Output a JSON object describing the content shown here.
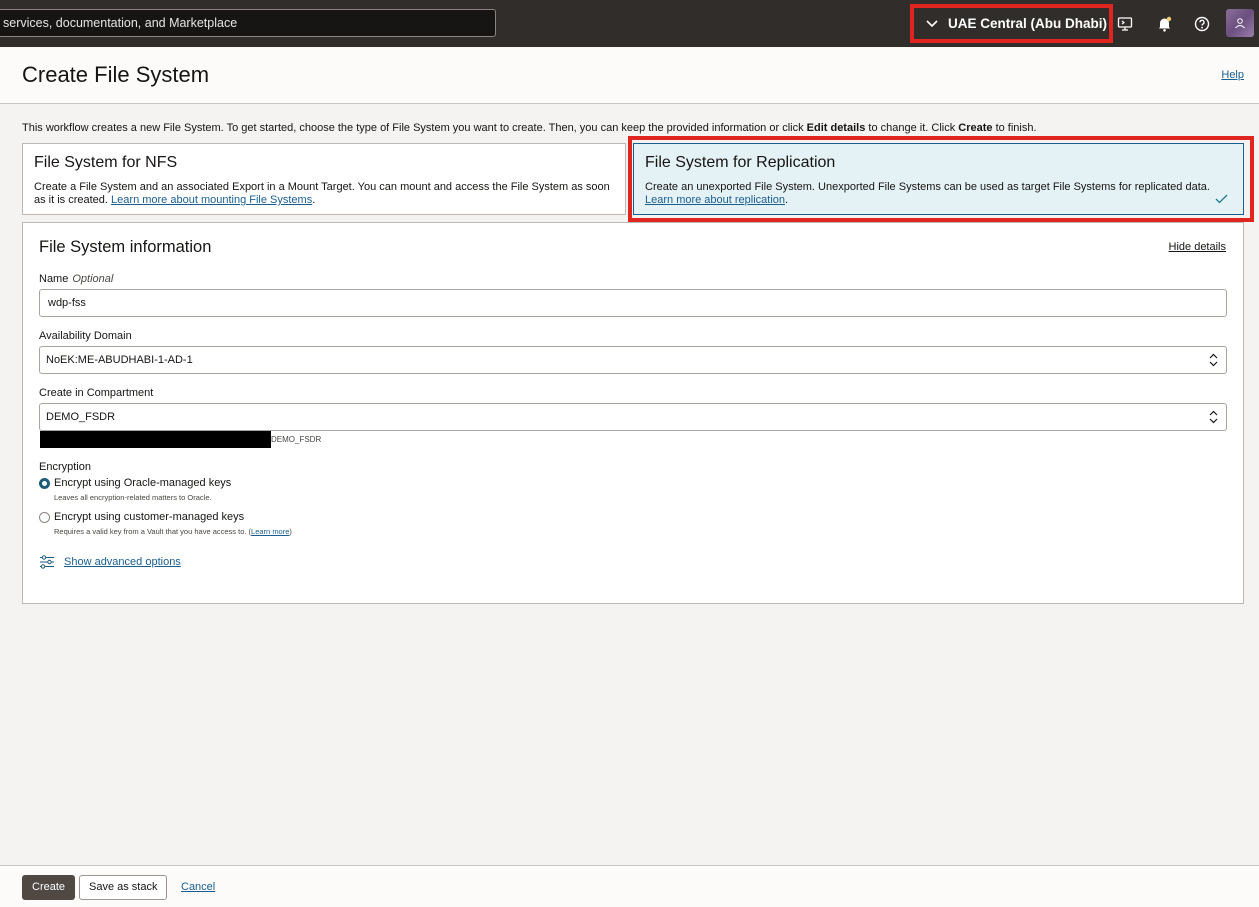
{
  "topbar": {
    "search_placeholder": "services, documentation, and Marketplace",
    "region": "UAE Central (Abu Dhabi)",
    "icons": [
      "cloud-shell-icon",
      "bell-icon",
      "help-icon",
      "avatar-icon"
    ]
  },
  "header": {
    "title": "Create File System",
    "help": "Help"
  },
  "intro": {
    "text1": "This workflow creates a new File System. To get started, choose the type of File System you want to create. Then, you can keep the provided information or click ",
    "bold1": "Edit details",
    "text2": " to change it. Click ",
    "bold2": "Create",
    "text3": " to finish."
  },
  "cards": {
    "nfs": {
      "title": "File System for NFS",
      "desc": "Create a File System and an associated Export in a Mount Target. You can mount and access the File System as soon as it is created. ",
      "link": "Learn more about mounting File Systems",
      "tail": "."
    },
    "replication": {
      "title": "File System for Replication",
      "desc": "Create an unexported File System. Unexported File Systems can be used as target File Systems for replicated data. ",
      "link": "Learn more about replication",
      "tail": ".",
      "selected": true
    }
  },
  "form": {
    "section_title": "File System information",
    "hide_details": "Hide details",
    "name_label": "Name",
    "name_optional": "Optional",
    "name_value": "wdp-fss",
    "ad_label": "Availability Domain",
    "ad_value": "NoEK:ME-ABUDHABI-1-AD-1",
    "compartment_label": "Create in Compartment",
    "compartment_value": "DEMO_FSDR",
    "compartment_path_tail": "DEMO_FSDR",
    "encryption_label": "Encryption",
    "enc_oracle_label": "Encrypt using Oracle-managed keys",
    "enc_oracle_sub": "Leaves all encryption-related matters to Oracle.",
    "enc_customer_label": "Encrypt using customer-managed keys",
    "enc_customer_sub": "Requires a valid key from a Vault that you have access to. (",
    "enc_customer_link": "Learn more",
    "enc_customer_tail": ")",
    "advanced": "Show advanced options"
  },
  "footer": {
    "create": "Create",
    "save_stack": "Save as stack",
    "cancel": "Cancel"
  },
  "colors": {
    "highlight": "#e0241f",
    "selected_bg": "#e4f1f5",
    "link": "#1a5e8f",
    "topbar": "#312d2a"
  }
}
